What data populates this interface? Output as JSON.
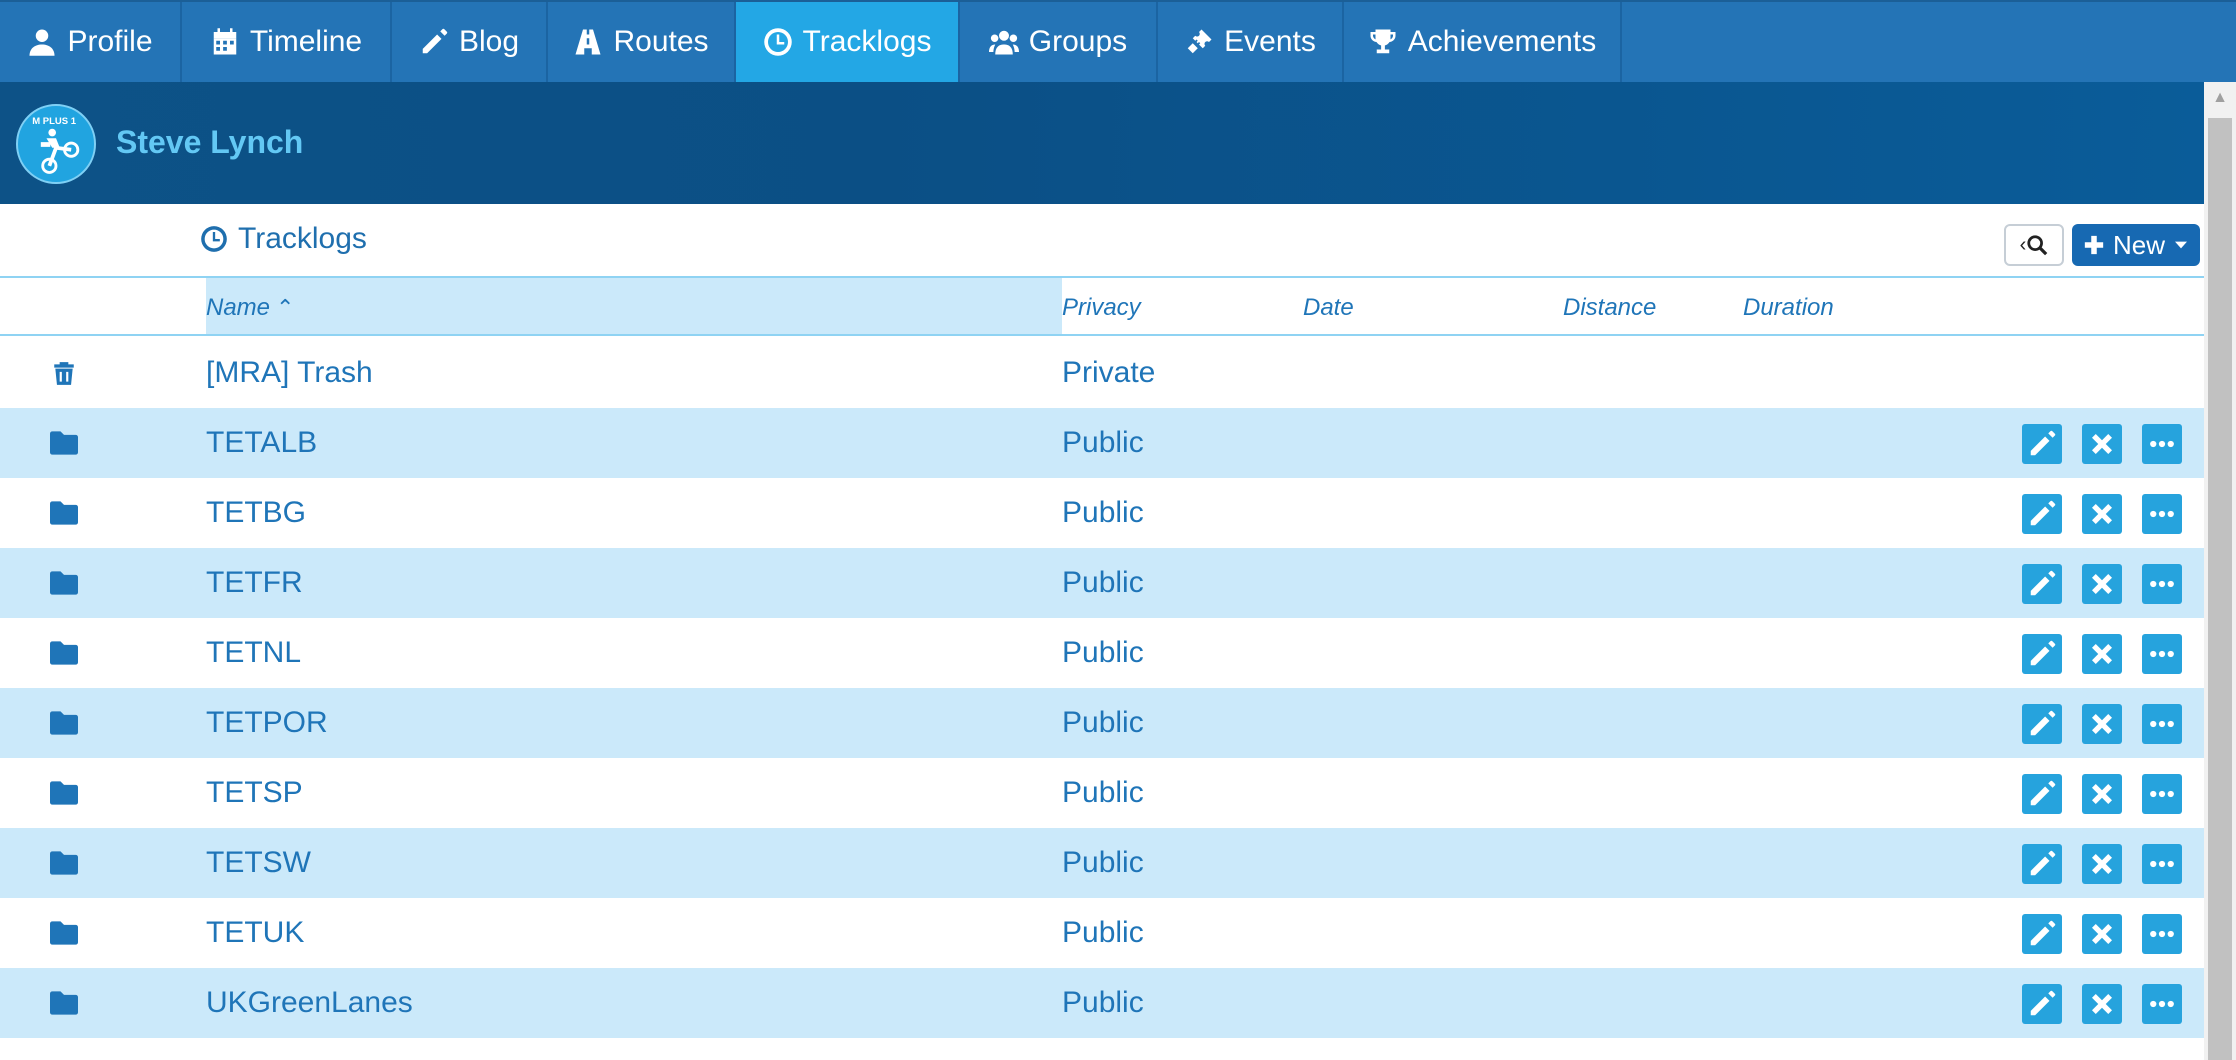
{
  "nav": {
    "tabs": [
      {
        "label": "Profile",
        "icon": "user-icon"
      },
      {
        "label": "Timeline",
        "icon": "calendar-icon"
      },
      {
        "label": "Blog",
        "icon": "pencil-icon"
      },
      {
        "label": "Routes",
        "icon": "road-icon"
      },
      {
        "label": "Tracklogs",
        "icon": "clock-icon",
        "active": true
      },
      {
        "label": "Groups",
        "icon": "users-icon"
      },
      {
        "label": "Events",
        "icon": "ticket-icon"
      },
      {
        "label": "Achievements",
        "icon": "trophy-icon"
      }
    ]
  },
  "profile": {
    "name": "Steve Lynch",
    "avatar_text": "M PLUS 1"
  },
  "section": {
    "title": "Tracklogs",
    "new_label": "New"
  },
  "table": {
    "columns": {
      "name": "Name",
      "privacy": "Privacy",
      "date": "Date",
      "distance": "Distance",
      "duration": "Duration"
    },
    "sort": {
      "column": "Name",
      "direction": "ascending"
    },
    "rows": [
      {
        "icon": "trash-icon",
        "name": "[MRA] Trash",
        "privacy": "Private",
        "actions": false
      },
      {
        "icon": "folder-icon",
        "name": "TETALB",
        "privacy": "Public",
        "actions": true
      },
      {
        "icon": "folder-icon",
        "name": "TETBG",
        "privacy": "Public",
        "actions": true
      },
      {
        "icon": "folder-icon",
        "name": "TETFR",
        "privacy": "Public",
        "actions": true
      },
      {
        "icon": "folder-icon",
        "name": "TETNL",
        "privacy": "Public",
        "actions": true
      },
      {
        "icon": "folder-icon",
        "name": "TETPOR",
        "privacy": "Public",
        "actions": true
      },
      {
        "icon": "folder-icon",
        "name": "TETSP",
        "privacy": "Public",
        "actions": true
      },
      {
        "icon": "folder-icon",
        "name": "TETSW",
        "privacy": "Public",
        "actions": true
      },
      {
        "icon": "folder-icon",
        "name": "TETUK",
        "privacy": "Public",
        "actions": true
      },
      {
        "icon": "folder-icon",
        "name": "UKGreenLanes",
        "privacy": "Public",
        "actions": true
      }
    ]
  },
  "colors": {
    "nav_bg": "#2474b6",
    "nav_active": "#23a7e5",
    "header_bg": "#0b4f85",
    "name_color": "#63c8f4",
    "row_alt": "#cbe9fa",
    "action_bg": "#26a3dd",
    "new_button": "#1769b2"
  }
}
